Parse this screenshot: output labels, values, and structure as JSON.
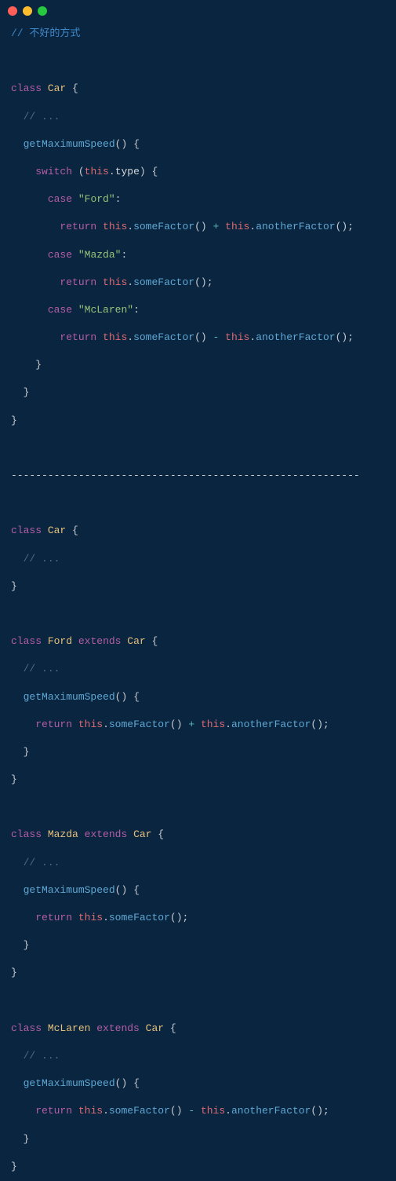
{
  "window": {
    "dots": [
      "close",
      "minimize",
      "zoom"
    ]
  },
  "code": {
    "top_comment": "// 不好的方式",
    "kw_class": "class",
    "kw_switch": "switch",
    "kw_case": "case",
    "kw_return": "return",
    "kw_extends": "extends",
    "kw_this": "this",
    "class_car": "Car",
    "class_ford": "Ford",
    "class_mazda": "Mazda",
    "class_mclaren": "McLaren",
    "method_getMax": "getMaximumSpeed",
    "method_some": "someFactor",
    "method_another": "anotherFactor",
    "prop_type": "type",
    "str_ford": "\"Ford\"",
    "str_mazda": "\"Mazda\"",
    "str_mclaren": "\"McLaren\"",
    "ellipsis": "// ...",
    "sep": "---------------------------------------------------------",
    "p_open": "(",
    "p_close": ")",
    "b_open": "{",
    "b_close": "}",
    "dot": ".",
    "colon": ":",
    "semi": ";",
    "plus": "+",
    "minus": "-"
  }
}
